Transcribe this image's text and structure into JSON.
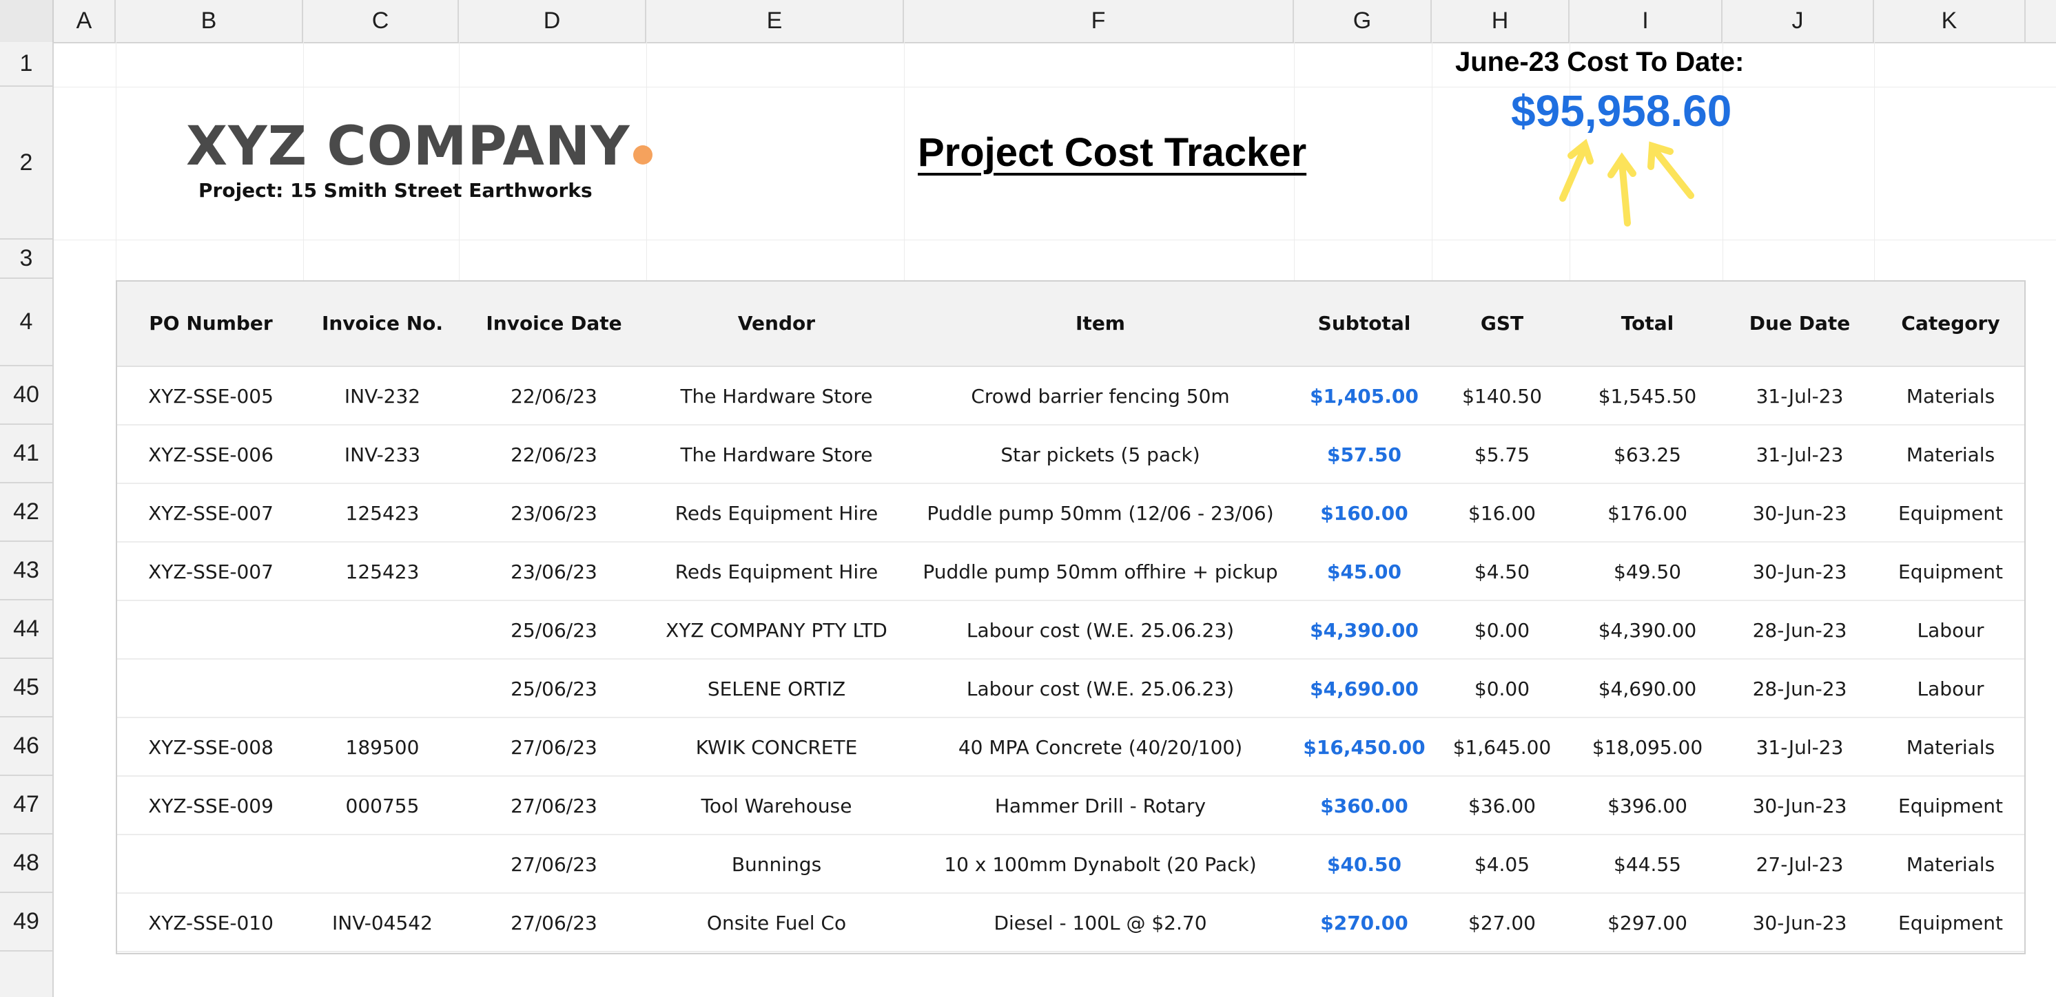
{
  "sheet": {
    "columns": [
      "A",
      "B",
      "C",
      "D",
      "E",
      "F",
      "G",
      "H",
      "I",
      "J",
      "K"
    ],
    "rows": [
      "1",
      "2",
      "3",
      "4",
      "40",
      "41",
      "42",
      "43",
      "44",
      "45",
      "46",
      "47",
      "48",
      "49"
    ]
  },
  "header": {
    "company": "XYZ COMPANY",
    "project": "Project:  15 Smith Street Earthworks",
    "title": "Project Cost Tracker",
    "cost_label": "June-23 Cost To Date:",
    "cost_value": "$95,958.60"
  },
  "colors": {
    "accent_blue": "#1f6fe0",
    "logo_dot": "#f5a25d",
    "arrow_yellow": "#fce35a"
  },
  "table": {
    "headers": [
      "PO Number",
      "Invoice No.",
      "Invoice Date",
      "Vendor",
      "Item",
      "Subtotal",
      "GST",
      "Total",
      "Due Date",
      "Category"
    ],
    "rows": [
      [
        "XYZ-SSE-005",
        "INV-232",
        "22/06/23",
        "The Hardware Store",
        "Crowd barrier fencing 50m",
        "$1,405.00",
        "$140.50",
        "$1,545.50",
        "31-Jul-23",
        "Materials"
      ],
      [
        "XYZ-SSE-006",
        "INV-233",
        "22/06/23",
        "The Hardware Store",
        "Star pickets (5 pack)",
        "$57.50",
        "$5.75",
        "$63.25",
        "31-Jul-23",
        "Materials"
      ],
      [
        "XYZ-SSE-007",
        "125423",
        "23/06/23",
        "Reds Equipment Hire",
        "Puddle pump 50mm (12/06 - 23/06)",
        "$160.00",
        "$16.00",
        "$176.00",
        "30-Jun-23",
        "Equipment"
      ],
      [
        "XYZ-SSE-007",
        "125423",
        "23/06/23",
        "Reds Equipment Hire",
        "Puddle pump 50mm offhire + pickup",
        "$45.00",
        "$4.50",
        "$49.50",
        "30-Jun-23",
        "Equipment"
      ],
      [
        "",
        "",
        "25/06/23",
        "XYZ COMPANY PTY LTD",
        "Labour cost (W.E. 25.06.23)",
        "$4,390.00",
        "$0.00",
        "$4,390.00",
        "28-Jun-23",
        "Labour"
      ],
      [
        "",
        "",
        "25/06/23",
        "SELENE ORTIZ",
        "Labour cost (W.E. 25.06.23)",
        "$4,690.00",
        "$0.00",
        "$4,690.00",
        "28-Jun-23",
        "Labour"
      ],
      [
        "XYZ-SSE-008",
        "189500",
        "27/06/23",
        "KWIK CONCRETE",
        "40 MPA Concrete (40/20/100)",
        "$16,450.00",
        "$1,645.00",
        "$18,095.00",
        "31-Jul-23",
        "Materials"
      ],
      [
        "XYZ-SSE-009",
        "000755",
        "27/06/23",
        "Tool Warehouse",
        "Hammer Drill - Rotary",
        "$360.00",
        "$36.00",
        "$396.00",
        "30-Jun-23",
        "Equipment"
      ],
      [
        "",
        "",
        "27/06/23",
        "Bunnings",
        "10 x 100mm Dynabolt (20 Pack)",
        "$40.50",
        "$4.05",
        "$44.55",
        "27-Jul-23",
        "Materials"
      ],
      [
        "XYZ-SSE-010",
        "INV-04542",
        "27/06/23",
        "Onsite Fuel Co",
        "Diesel - 100L @ $2.70",
        "$270.00",
        "$27.00",
        "$297.00",
        "30-Jun-23",
        "Equipment"
      ]
    ]
  }
}
